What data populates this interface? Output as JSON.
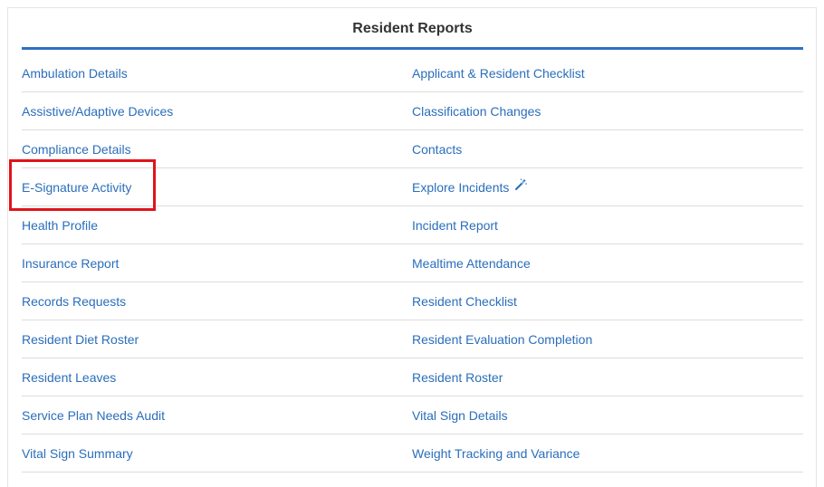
{
  "panel": {
    "title": "Resident Reports"
  },
  "reports": {
    "left": [
      "Ambulation Details",
      "Assistive/Adaptive Devices",
      "Compliance Details",
      "E-Signature Activity",
      "Health Profile",
      "Insurance Report",
      "Records Requests",
      "Resident Diet Roster",
      "Resident Leaves",
      "Service Plan Needs Audit",
      "Vital Sign Summary"
    ],
    "right": [
      "Applicant & Resident Checklist",
      "Classification Changes",
      "Contacts",
      "Explore Incidents",
      "Incident Report",
      "Mealtime Attendance",
      "Resident Checklist",
      "Resident Evaluation Completion",
      "Resident Roster",
      "Vital Sign Details",
      "Weight Tracking and Variance"
    ]
  },
  "icons": {
    "explore_incidents": "magic-wand-icon"
  },
  "colors": {
    "accent": "#2f6fc3",
    "link": "#2a6ebb",
    "highlight": "#e0141a"
  }
}
